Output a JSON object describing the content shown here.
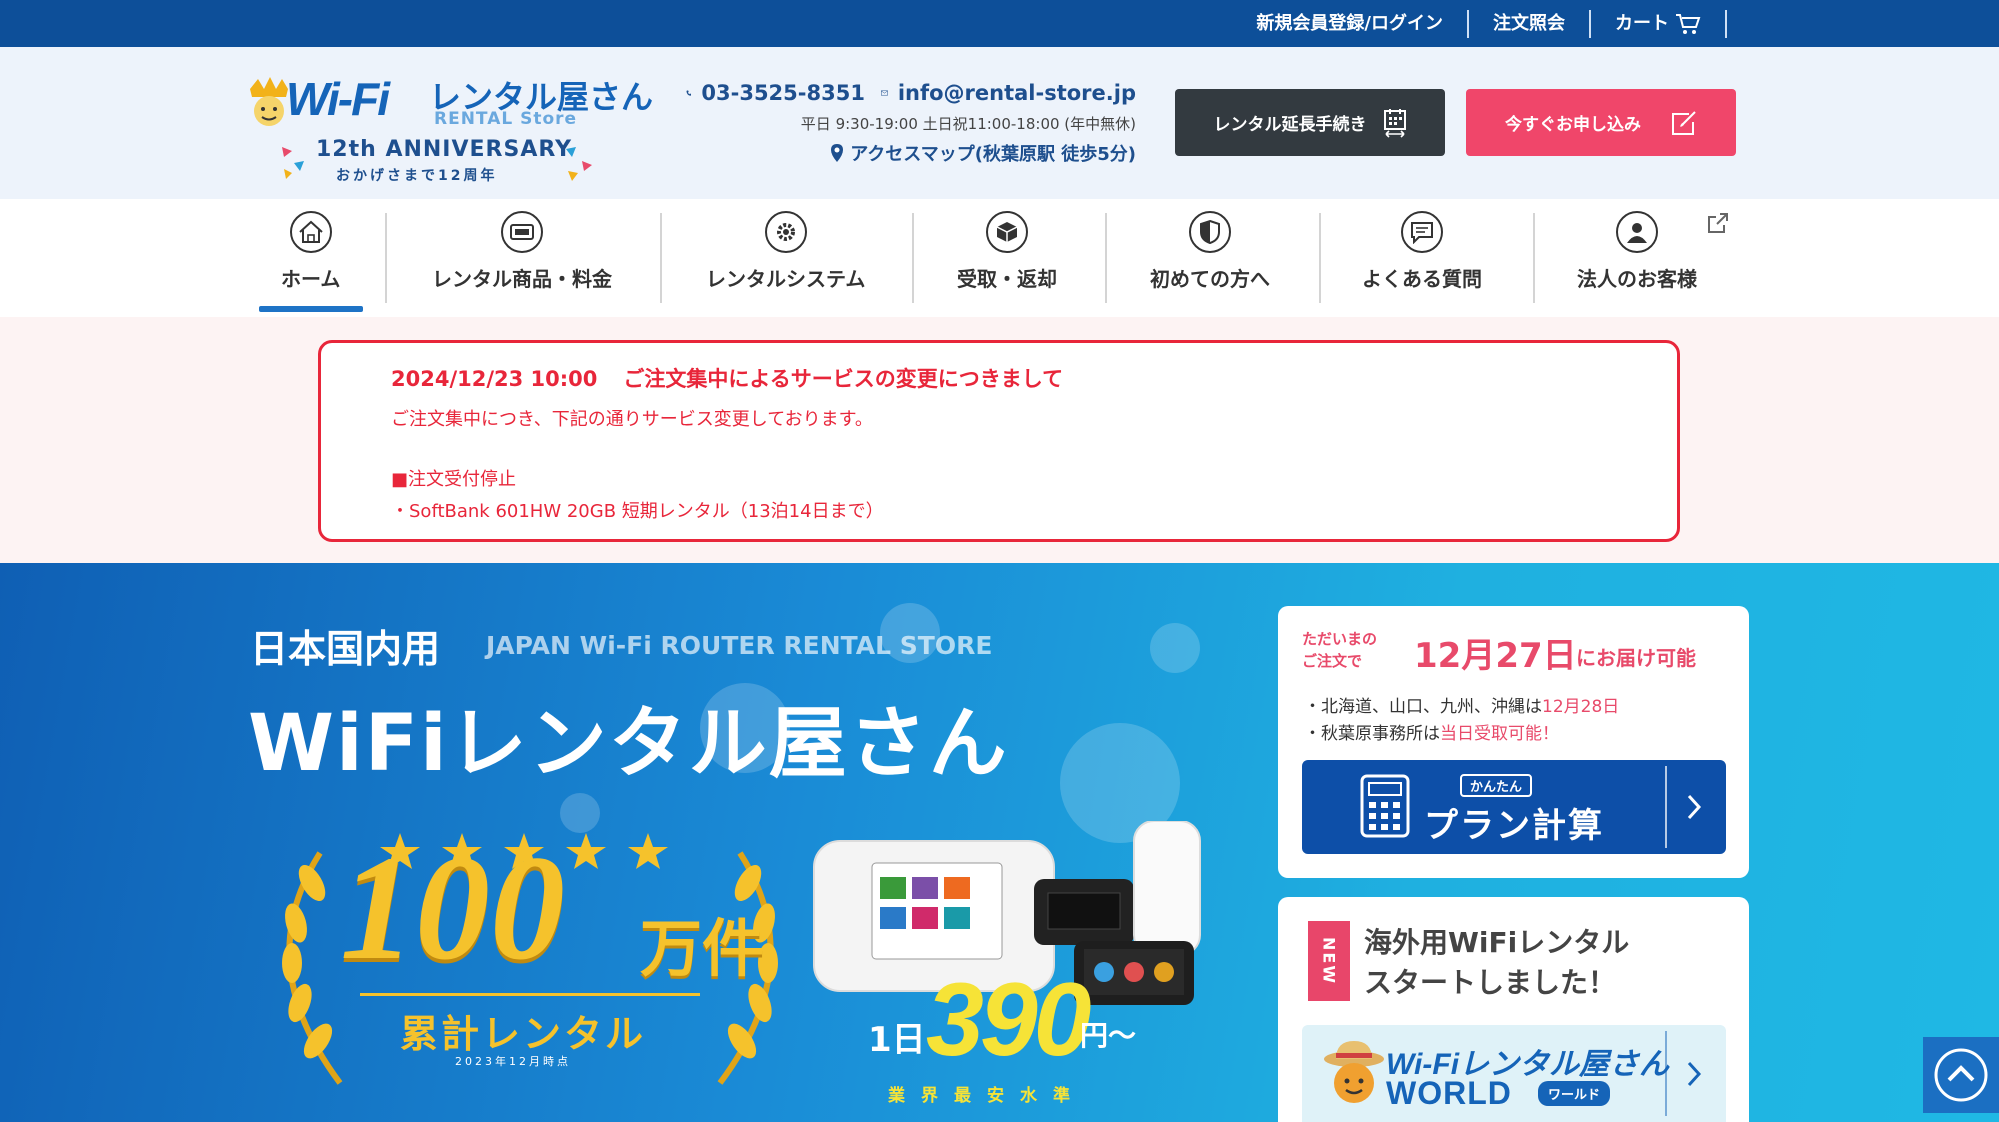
{
  "topbar": {
    "register_login": "新規会員登録/ログイン",
    "order_inquiry": "注文照会",
    "cart": "カート"
  },
  "header": {
    "logo": {
      "brand": "Wi-Fi",
      "brand_jp": "レンタル屋さん",
      "brand_sub": "RENTAL Store",
      "anniversary": "12th ANNIVERSARY",
      "anniversary_sub": "おかげさまで12周年"
    },
    "phone": "03-3525-8351",
    "email": "info@rental-store.jp",
    "hours": "平日 9:30-19:00 土日祝11:00-18:00 (年中無休)",
    "access": "アクセスマップ(秋葉原駅 徒歩5分)",
    "extend_button": "レンタル延長手続き",
    "apply_button": "今すぐお申し込み"
  },
  "nav": {
    "items": [
      {
        "label": "ホーム",
        "icon": "home-icon"
      },
      {
        "label": "レンタル商品・料金",
        "icon": "router-icon"
      },
      {
        "label": "レンタルシステム",
        "icon": "gear-icon"
      },
      {
        "label": "受取・返却",
        "icon": "package-icon"
      },
      {
        "label": "初めての方へ",
        "icon": "shield-icon"
      },
      {
        "label": "よくある質問",
        "icon": "chat-icon"
      },
      {
        "label": "法人のお客様",
        "icon": "person-icon"
      }
    ]
  },
  "notice": {
    "date": "2024/12/23 10:00",
    "title": "ご注文集中によるサービスの変更につきまして",
    "line1": "ご注文集中につき、下記の通りサービス変更しております。",
    "line2": "■注文受付停止",
    "line3": "・SoftBank 601HW 20GB 短期レンタル（13泊14日まで）"
  },
  "hero": {
    "domestic": "日本国内用",
    "english": "JAPAN Wi-Fi ROUTER RENTAL STORE",
    "main_title": "WiFiレンタル屋さん",
    "award_number": "100",
    "award_unit": "万件",
    "award_label": "累計レンタル",
    "award_asof": "2023年12月時点",
    "price_prefix": "1日",
    "price_value": "390",
    "price_suffix": "円〜",
    "price_note": "業界最安水準"
  },
  "delivery": {
    "lead1": "ただいまの",
    "lead2": "ご注文で",
    "date": "12月27日",
    "available": "にお届け可能",
    "bullet1_prefix": "・北海道、山口、九州、沖縄は",
    "bullet1_date": "12月28日",
    "bullet2_prefix": "・秋葉原事務所は",
    "bullet2_highlight": "当日受取可能！",
    "calc_tag": "かんたん",
    "calc_label": "プラン計算"
  },
  "overseas": {
    "new_badge": "NEW",
    "line1": "海外用WiFiレンタル",
    "line2": "スタートしました！",
    "world_brand": "Wi-Fiレンタル屋さん",
    "world_text": "WORLD",
    "world_badge": "ワールド"
  },
  "colors": {
    "topbar": "#0d4f99",
    "accent_pink": "#f0466a",
    "notice_red": "#e8263a",
    "brand_blue": "#1564b8",
    "gold": "#f5c22c",
    "yellow": "#f6e337"
  }
}
